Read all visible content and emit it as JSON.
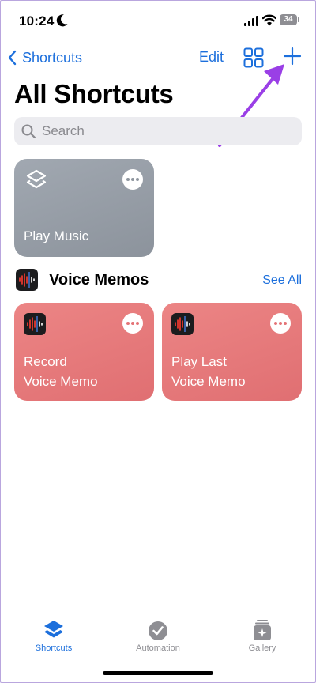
{
  "status_bar": {
    "time": "10:24",
    "battery": "34"
  },
  "nav": {
    "back_label": "Shortcuts",
    "edit_label": "Edit"
  },
  "page": {
    "title": "All Shortcuts"
  },
  "search": {
    "placeholder": "Search"
  },
  "shortcuts": [
    {
      "label": "Play Music",
      "color": "#959ca5",
      "icon": "layers-icon"
    }
  ],
  "section": {
    "title": "Voice Memos",
    "see_all_label": "See All",
    "icon": "voice-memos-app-icon",
    "items": [
      {
        "line1": "Record",
        "line2": "Voice Memo",
        "color": "#e57a7c"
      },
      {
        "line1": "Play Last",
        "line2": "Voice Memo",
        "color": "#e57a7c"
      }
    ]
  },
  "tab_bar": {
    "tabs": [
      {
        "label": "Shortcuts",
        "icon": "layers-icon",
        "active": true
      },
      {
        "label": "Automation",
        "icon": "checkmark-clock-icon",
        "active": false
      },
      {
        "label": "Gallery",
        "icon": "gallery-icon",
        "active": false
      }
    ]
  },
  "colors": {
    "accent": "#1c6fdc",
    "annotation_arrow": "#9a3fe6"
  }
}
